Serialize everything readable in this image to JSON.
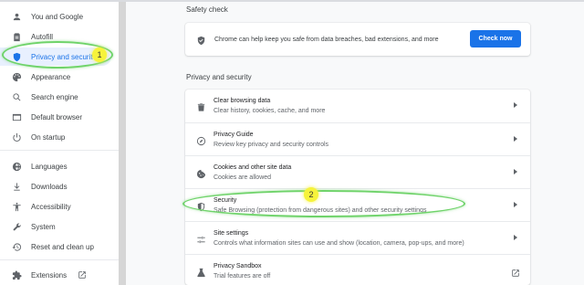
{
  "sidebar": {
    "items": [
      {
        "label": "You and Google",
        "icon": "person-icon"
      },
      {
        "label": "Autofill",
        "icon": "clipboard-icon"
      },
      {
        "label": "Privacy and securit",
        "icon": "shield-icon",
        "active": true
      },
      {
        "label": "Appearance",
        "icon": "palette-icon"
      },
      {
        "label": "Search engine",
        "icon": "search-icon"
      },
      {
        "label": "Default browser",
        "icon": "browser-icon"
      },
      {
        "label": "On startup",
        "icon": "power-icon"
      },
      {
        "label": "Languages",
        "icon": "globe-icon"
      },
      {
        "label": "Downloads",
        "icon": "download-icon"
      },
      {
        "label": "Accessibility",
        "icon": "accessibility-icon"
      },
      {
        "label": "System",
        "icon": "wrench-icon"
      },
      {
        "label": "Reset and clean up",
        "icon": "reset-icon"
      },
      {
        "label": "Extensions",
        "icon": "puzzle-icon"
      }
    ]
  },
  "safety_check": {
    "heading": "Safety check",
    "text": "Chrome can help keep you safe from data breaches, bad extensions, and more",
    "button": "Check now"
  },
  "privacy": {
    "heading": "Privacy and security",
    "rows": [
      {
        "title": "Clear browsing data",
        "subtitle": "Clear history, cookies, cache, and more",
        "icon": "trash-icon"
      },
      {
        "title": "Privacy Guide",
        "subtitle": "Review key privacy and security controls",
        "icon": "compass-icon"
      },
      {
        "title": "Cookies and other site data",
        "subtitle": "Cookies are allowed",
        "icon": "cookie-icon"
      },
      {
        "title": "Security",
        "subtitle": "Safe Browsing (protection from dangerous sites) and other security settings",
        "icon": "shield-icon"
      },
      {
        "title": "Site settings",
        "subtitle": "Controls what information sites can use and show (location, camera, pop-ups, and more)",
        "icon": "sliders-icon"
      },
      {
        "title": "Privacy Sandbox",
        "subtitle": "Trial features are off",
        "icon": "flask-icon"
      }
    ]
  },
  "annotations": {
    "badge1": "1",
    "badge2": "2",
    "color_highlight": "#6fd36a",
    "color_badge": "#f6f33b"
  },
  "colors": {
    "accent": "#1a73e8",
    "active_bg": "#e8f0fe"
  }
}
